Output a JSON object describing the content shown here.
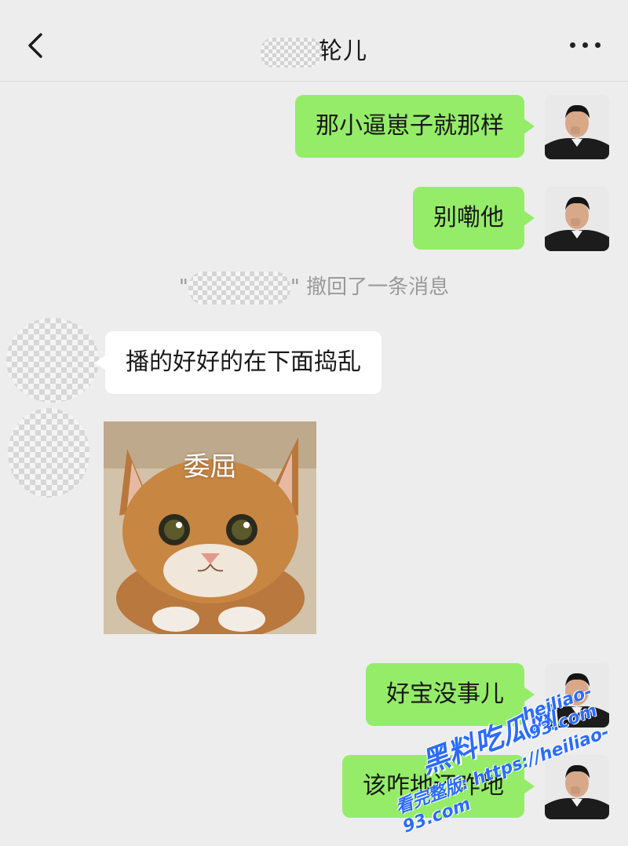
{
  "header": {
    "title_visible": "轮儿",
    "back_icon": "chevron-left-icon",
    "more_icon": "ellipsis-icon"
  },
  "messages": [
    {
      "side": "me",
      "text": "那小逼崽子就那样"
    },
    {
      "side": "me",
      "text": "别嘞他"
    },
    {
      "side": "system",
      "text": "\" \" 撤回了一条消息"
    },
    {
      "side": "them",
      "text": "播的好好的在下面捣乱"
    },
    {
      "side": "them",
      "type": "sticker",
      "caption": "委屈"
    },
    {
      "side": "me",
      "text": "好宝没事儿"
    },
    {
      "side": "me",
      "text": "该咋地还咋地"
    }
  ],
  "watermark": {
    "brand": "黑料吃瓜网",
    "url": "heiliao-93.com",
    "line": "看完整版: https://heiliao-93.com"
  },
  "colors": {
    "background": "#ededed",
    "outgoing_bubble": "#95ec69",
    "incoming_bubble": "#ffffff",
    "system_text": "#9a9a9a",
    "watermark": "#2b6bff"
  }
}
